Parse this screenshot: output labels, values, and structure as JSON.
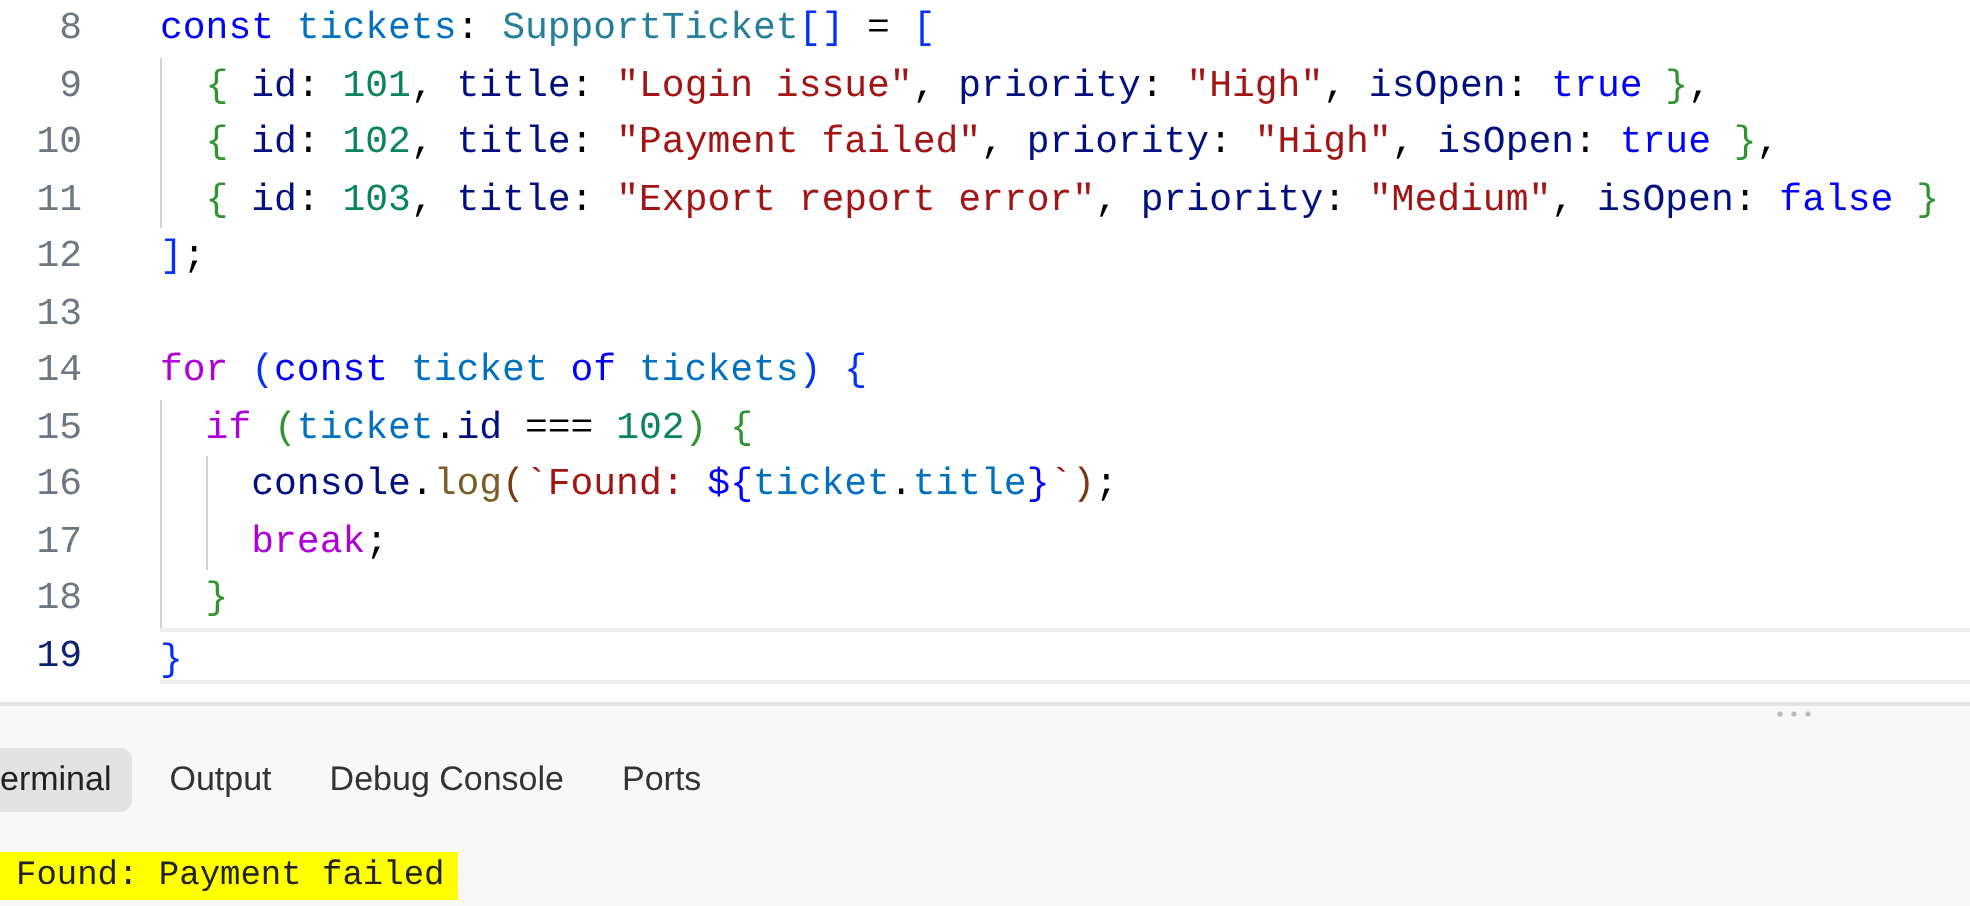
{
  "editor": {
    "lines": [
      {
        "number": "8",
        "current": false,
        "tokens": [
          {
            "kind": "keyword",
            "text": "const "
          },
          {
            "kind": "constant",
            "text": "tickets"
          },
          {
            "kind": "plain",
            "text": ": "
          },
          {
            "kind": "type",
            "text": "SupportTicket"
          },
          {
            "kind": "bracket1",
            "text": "[]"
          },
          {
            "kind": "plain",
            "text": " = "
          },
          {
            "kind": "bracket1",
            "text": "["
          }
        ]
      },
      {
        "number": "9",
        "current": false,
        "tokens": [
          {
            "kind": "bracket2",
            "text": "  {"
          },
          {
            "kind": "variable",
            "text": " id"
          },
          {
            "kind": "plain",
            "text": ": "
          },
          {
            "kind": "number",
            "text": "101"
          },
          {
            "kind": "plain",
            "text": ", "
          },
          {
            "kind": "variable",
            "text": "title"
          },
          {
            "kind": "plain",
            "text": ": "
          },
          {
            "kind": "string",
            "text": "\"Login issue\""
          },
          {
            "kind": "plain",
            "text": ", "
          },
          {
            "kind": "variable",
            "text": "priority"
          },
          {
            "kind": "plain",
            "text": ": "
          },
          {
            "kind": "string",
            "text": "\"High\""
          },
          {
            "kind": "plain",
            "text": ", "
          },
          {
            "kind": "variable",
            "text": "isOpen"
          },
          {
            "kind": "plain",
            "text": ": "
          },
          {
            "kind": "keyword",
            "text": "true"
          },
          {
            "kind": "bracket2",
            "text": " }"
          },
          {
            "kind": "plain",
            "text": ","
          }
        ]
      },
      {
        "number": "10",
        "current": false,
        "tokens": [
          {
            "kind": "bracket2",
            "text": "  {"
          },
          {
            "kind": "variable",
            "text": " id"
          },
          {
            "kind": "plain",
            "text": ": "
          },
          {
            "kind": "number",
            "text": "102"
          },
          {
            "kind": "plain",
            "text": ", "
          },
          {
            "kind": "variable",
            "text": "title"
          },
          {
            "kind": "plain",
            "text": ": "
          },
          {
            "kind": "string",
            "text": "\"Payment failed\""
          },
          {
            "kind": "plain",
            "text": ", "
          },
          {
            "kind": "variable",
            "text": "priority"
          },
          {
            "kind": "plain",
            "text": ": "
          },
          {
            "kind": "string",
            "text": "\"High\""
          },
          {
            "kind": "plain",
            "text": ", "
          },
          {
            "kind": "variable",
            "text": "isOpen"
          },
          {
            "kind": "plain",
            "text": ": "
          },
          {
            "kind": "keyword",
            "text": "true"
          },
          {
            "kind": "bracket2",
            "text": " }"
          },
          {
            "kind": "plain",
            "text": ","
          }
        ]
      },
      {
        "number": "11",
        "current": false,
        "tokens": [
          {
            "kind": "bracket2",
            "text": "  {"
          },
          {
            "kind": "variable",
            "text": " id"
          },
          {
            "kind": "plain",
            "text": ": "
          },
          {
            "kind": "number",
            "text": "103"
          },
          {
            "kind": "plain",
            "text": ", "
          },
          {
            "kind": "variable",
            "text": "title"
          },
          {
            "kind": "plain",
            "text": ": "
          },
          {
            "kind": "string",
            "text": "\"Export report error\""
          },
          {
            "kind": "plain",
            "text": ", "
          },
          {
            "kind": "variable",
            "text": "priority"
          },
          {
            "kind": "plain",
            "text": ": "
          },
          {
            "kind": "string",
            "text": "\"Medium\""
          },
          {
            "kind": "plain",
            "text": ", "
          },
          {
            "kind": "variable",
            "text": "isOpen"
          },
          {
            "kind": "plain",
            "text": ": "
          },
          {
            "kind": "keyword",
            "text": "false"
          },
          {
            "kind": "bracket2",
            "text": " }"
          }
        ]
      },
      {
        "number": "12",
        "current": false,
        "tokens": [
          {
            "kind": "bracket1",
            "text": "]"
          },
          {
            "kind": "plain",
            "text": ";"
          }
        ]
      },
      {
        "number": "13",
        "current": false
      },
      {
        "number": "14",
        "current": false,
        "tokens": [
          {
            "kind": "control",
            "text": "for "
          },
          {
            "kind": "bracket1",
            "text": "("
          },
          {
            "kind": "keyword",
            "text": "const "
          },
          {
            "kind": "constant",
            "text": "ticket "
          },
          {
            "kind": "keyword",
            "text": "of "
          },
          {
            "kind": "constant",
            "text": "tickets"
          },
          {
            "kind": "bracket1",
            "text": ")"
          },
          {
            "kind": "bracket1",
            "text": " {"
          }
        ]
      },
      {
        "number": "15",
        "current": false,
        "tokens": [
          {
            "kind": "control",
            "text": "  if "
          },
          {
            "kind": "bracket2",
            "text": "("
          },
          {
            "kind": "constant",
            "text": "ticket"
          },
          {
            "kind": "plain",
            "text": "."
          },
          {
            "kind": "variable",
            "text": "id"
          },
          {
            "kind": "plain",
            "text": " === "
          },
          {
            "kind": "number",
            "text": "102"
          },
          {
            "kind": "bracket2",
            "text": ")"
          },
          {
            "kind": "bracket2",
            "text": " {"
          }
        ]
      },
      {
        "number": "16",
        "current": false,
        "tokens": [
          {
            "kind": "variable",
            "text": "    console"
          },
          {
            "kind": "plain",
            "text": "."
          },
          {
            "kind": "function",
            "text": "log"
          },
          {
            "kind": "bracket3",
            "text": "("
          },
          {
            "kind": "string",
            "text": "`Found: "
          },
          {
            "kind": "keyword",
            "text": "${"
          },
          {
            "kind": "constant",
            "text": "ticket"
          },
          {
            "kind": "plain",
            "text": "."
          },
          {
            "kind": "constant",
            "text": "title"
          },
          {
            "kind": "keyword",
            "text": "}"
          },
          {
            "kind": "string",
            "text": "`"
          },
          {
            "kind": "bracket3",
            "text": ")"
          },
          {
            "kind": "plain",
            "text": ";"
          }
        ]
      },
      {
        "number": "17",
        "current": false,
        "tokens": [
          {
            "kind": "control",
            "text": "    break"
          },
          {
            "kind": "plain",
            "text": ";"
          }
        ]
      },
      {
        "number": "18",
        "current": false,
        "tokens": [
          {
            "kind": "bracket2",
            "text": "  }"
          }
        ]
      },
      {
        "number": "19",
        "current": true,
        "tokens": [
          {
            "kind": "bracket1",
            "text": "}"
          }
        ]
      }
    ]
  },
  "panel": {
    "tabs": [
      {
        "label": "erminal",
        "selected": true
      },
      {
        "label": "Output",
        "selected": false
      },
      {
        "label": "Debug Console",
        "selected": false
      },
      {
        "label": "Ports",
        "selected": false
      }
    ],
    "output": "Found: Payment failed"
  }
}
